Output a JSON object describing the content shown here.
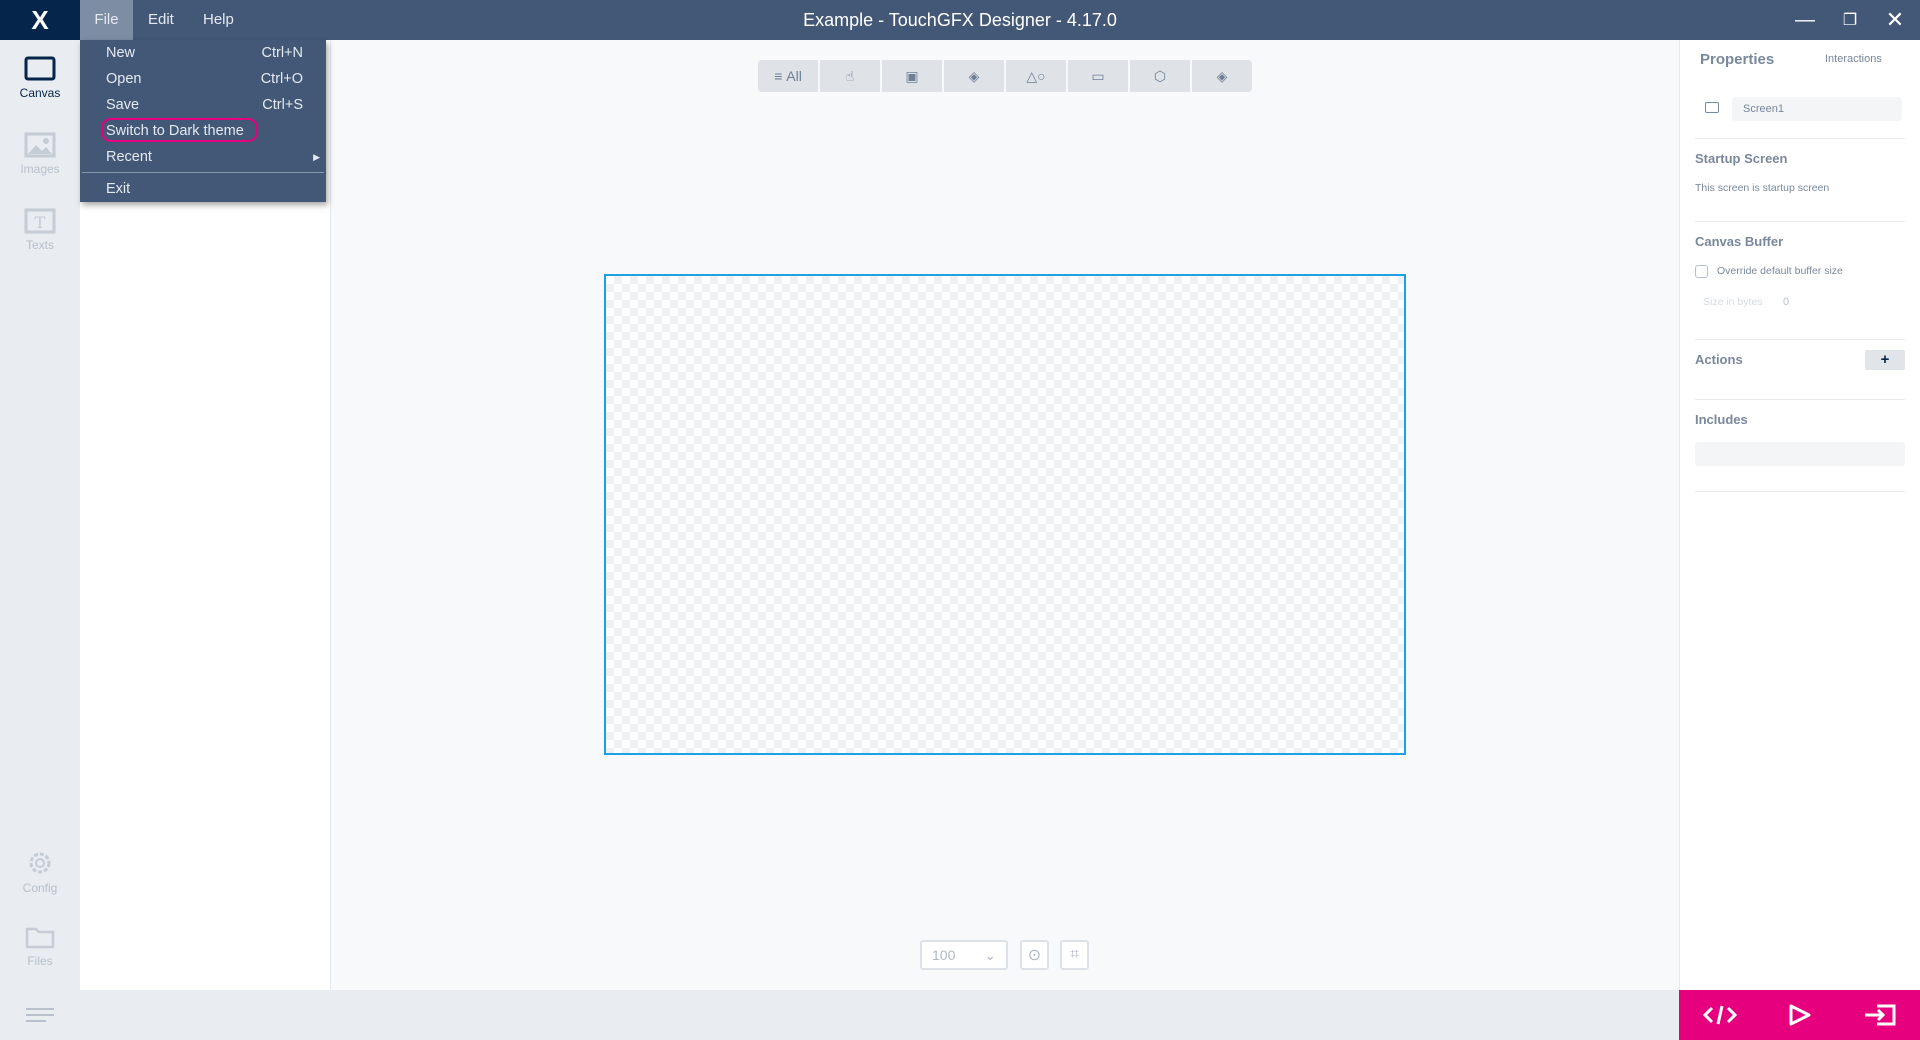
{
  "window": {
    "title": "Example - TouchGFX Designer - 4.17.0",
    "logo": "X"
  },
  "menubar": {
    "file": "File",
    "edit": "Edit",
    "help": "Help"
  },
  "file_menu": {
    "items": [
      {
        "label": "New",
        "shortcut": "Ctrl+N"
      },
      {
        "label": "Open",
        "shortcut": "Ctrl+O"
      },
      {
        "label": "Save",
        "shortcut": "Ctrl+S"
      },
      {
        "label": "Switch to Dark theme",
        "shortcut": ""
      },
      {
        "label": "Recent",
        "shortcut": ""
      },
      {
        "label": "Exit",
        "shortcut": ""
      }
    ]
  },
  "rail": {
    "canvas": "Canvas",
    "images": "Images",
    "texts": "Texts",
    "config": "Config",
    "files": "Files"
  },
  "toolbar": {
    "all": "All"
  },
  "properties": {
    "tab_properties": "Properties",
    "tab_interactions": "Interactions",
    "screen_name": "Screen1",
    "startup_heading": "Startup Screen",
    "startup_text": "This screen is startup screen",
    "buffer_heading": "Canvas Buffer",
    "override_label": "Override default buffer size",
    "size_label": "Size in bytes",
    "size_value": "0",
    "actions_heading": "Actions",
    "add_label": "+",
    "includes_heading": "Includes"
  },
  "zoom": {
    "value": "100"
  },
  "colors": {
    "accent": "#e6007e",
    "titlebar": "#435877",
    "canvas_border": "#1da1e2"
  }
}
